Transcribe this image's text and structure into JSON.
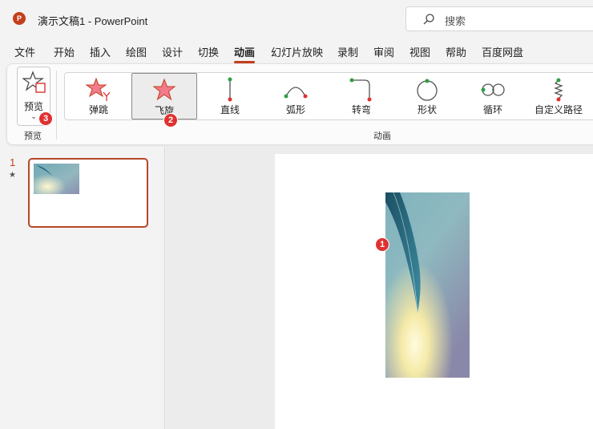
{
  "window": {
    "app_logo_letter": "P",
    "title": "演示文稿1  -  PowerPoint",
    "search_placeholder": "搜索"
  },
  "menu": {
    "tabs": [
      "文件",
      "开始",
      "插入",
      "绘图",
      "设计",
      "切换",
      "动画",
      "幻灯片放映",
      "录制",
      "审阅",
      "视图",
      "帮助",
      "百度网盘"
    ],
    "active_tab": "动画"
  },
  "ribbon": {
    "preview": {
      "label": "预览",
      "group_label": "预览"
    },
    "animations_group_label": "动画",
    "animations": [
      {
        "label": "弹跳",
        "icon": "bounce-star-icon"
      },
      {
        "label": "飞旋",
        "icon": "spin-star-icon"
      },
      {
        "label": "直线",
        "icon": "line-path-icon"
      },
      {
        "label": "弧形",
        "icon": "arc-path-icon"
      },
      {
        "label": "转弯",
        "icon": "turn-path-icon"
      },
      {
        "label": "形状",
        "icon": "shape-path-icon"
      },
      {
        "label": "循环",
        "icon": "loop-path-icon"
      },
      {
        "label": "自定义路径",
        "icon": "custom-path-icon"
      }
    ],
    "selected_animation": "飞旋"
  },
  "badges": {
    "picture": "1",
    "animation": "2",
    "preview": "3"
  },
  "thumbnails": [
    {
      "number": "1",
      "has_animation_star": "★"
    }
  ],
  "colors": {
    "accent": "#c43e1c",
    "badge": "#e03131"
  }
}
